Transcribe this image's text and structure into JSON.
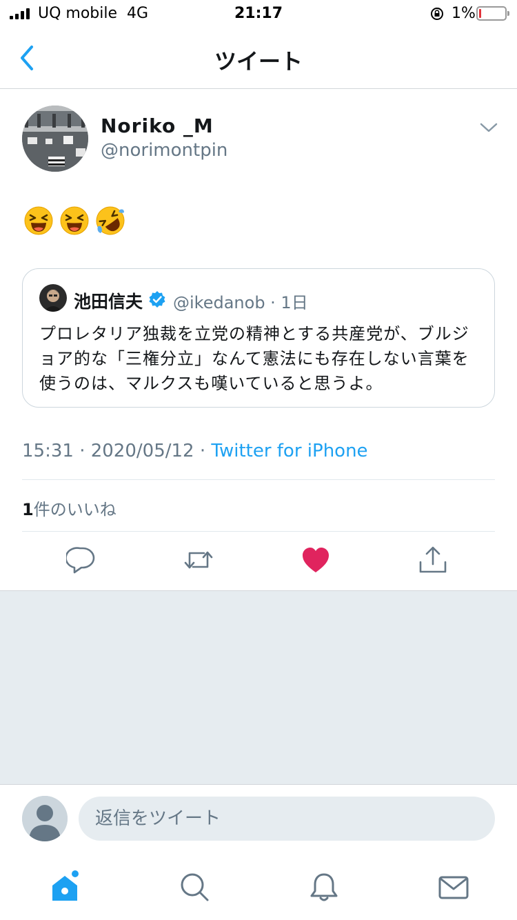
{
  "status_bar": {
    "carrier": "UQ mobile",
    "network": "4G",
    "time": "21:17",
    "battery_percent": "1%",
    "battery_level": 0.01
  },
  "nav": {
    "title": "ツイート",
    "back_icon": "chevron-left-icon"
  },
  "tweet": {
    "display_name": "Noriko _M",
    "username": "@norimontpin",
    "emojis": [
      "😆",
      "😆",
      "🤣"
    ],
    "quoted": {
      "name": "池田信夫",
      "handle_time": "@ikedanob · 1日",
      "text": "プロレタリア独裁を立党の精神とする共産党が、ブルジョア的な「三権分立」なんて憲法にも存在しない言葉を使うのは、マルクスも嘆いていると思うよ。"
    },
    "timestamp": "15:31 · 2020/05/12 · ",
    "source": "Twitter for iPhone",
    "likes_count": "1",
    "likes_label": "件のいいね"
  },
  "actions": [
    "reply-icon",
    "retweet-icon",
    "like-icon",
    "share-icon"
  ],
  "reply": {
    "placeholder": "返信をツイート"
  },
  "tabbar": [
    "home-icon",
    "search-icon",
    "notifications-icon",
    "messages-icon"
  ],
  "colors": {
    "accent": "#1da1f2",
    "like": "#e0245e",
    "secondary_text": "#657786",
    "background_gray": "#e6ecf0"
  }
}
